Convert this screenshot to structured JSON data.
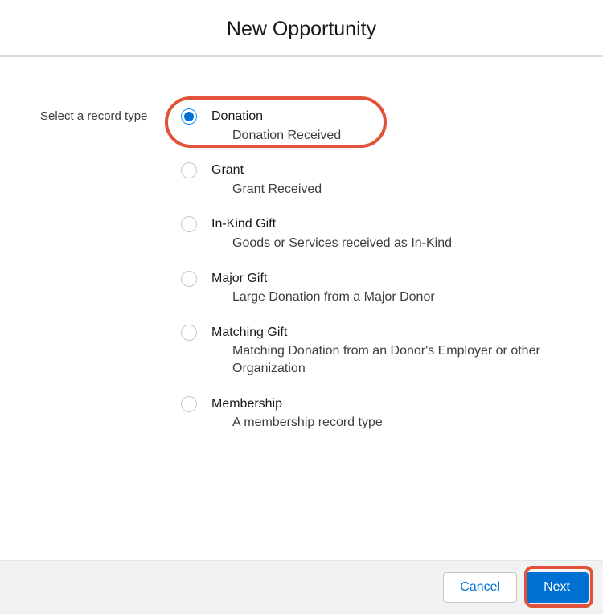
{
  "modal": {
    "title": "New Opportunity",
    "prompt": "Select a record type"
  },
  "options": [
    {
      "label": "Donation",
      "description": "Donation Received",
      "selected": true
    },
    {
      "label": "Grant",
      "description": "Grant Received",
      "selected": false
    },
    {
      "label": "In-Kind Gift",
      "description": "Goods or Services received as In-Kind",
      "selected": false
    },
    {
      "label": "Major Gift",
      "description": "Large Donation from a Major Donor",
      "selected": false
    },
    {
      "label": "Matching Gift",
      "description": "Matching Donation from an Donor's Employer or other Organization",
      "selected": false
    },
    {
      "label": "Membership",
      "description": "A membership record type",
      "selected": false
    }
  ],
  "footer": {
    "cancel": "Cancel",
    "next": "Next"
  }
}
